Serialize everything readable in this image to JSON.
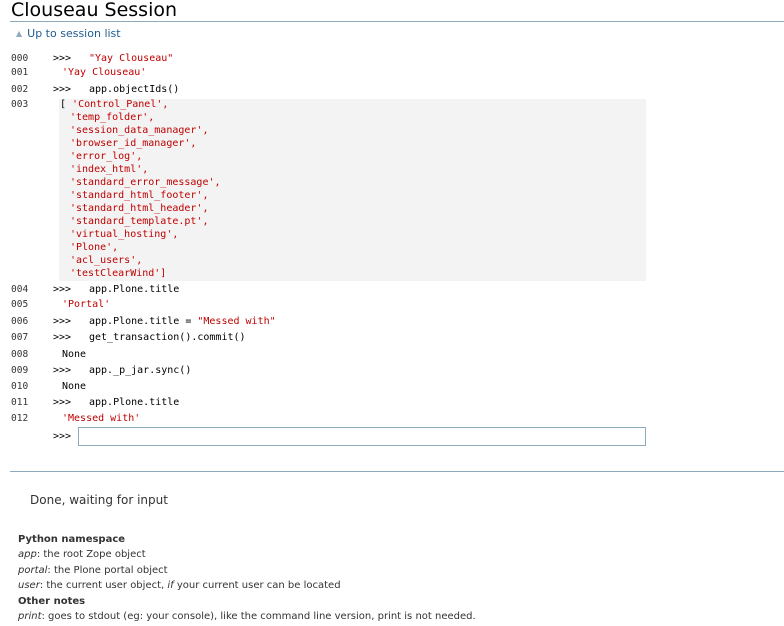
{
  "header": {
    "title": "Clouseau Session",
    "up_link": "Up to session list"
  },
  "console": {
    "prompt": ">>>",
    "rows": [
      {
        "n": "000",
        "kind": "in",
        "code": "",
        "str": "\"Yay Clouseau\""
      },
      {
        "n": "001",
        "kind": "out",
        "text": "'Yay Clouseau'",
        "red": true
      },
      {
        "n": "002",
        "kind": "in",
        "code": "app.objectIds()",
        "str": ""
      },
      {
        "n": "003",
        "kind": "list"
      },
      {
        "n": "004",
        "kind": "in",
        "code": "app.Plone.title",
        "str": ""
      },
      {
        "n": "005",
        "kind": "out",
        "text": "'Portal'",
        "red": true
      },
      {
        "n": "006",
        "kind": "in",
        "code": "app.Plone.title = ",
        "str": "\"Messed with\""
      },
      {
        "n": "007",
        "kind": "in",
        "code": "get_transaction().commit()",
        "str": ""
      },
      {
        "n": "008",
        "kind": "out",
        "text": "None",
        "red": false
      },
      {
        "n": "009",
        "kind": "in",
        "code": "app._p_jar.sync()",
        "str": ""
      },
      {
        "n": "010",
        "kind": "out",
        "text": "None",
        "red": false
      },
      {
        "n": "011",
        "kind": "in",
        "code": "app.Plone.title",
        "str": ""
      },
      {
        "n": "012",
        "kind": "out",
        "text": "'Messed with'",
        "red": true
      }
    ],
    "list_items": [
      "'Control_Panel',",
      "'temp_folder',",
      "'session_data_manager',",
      "'browser_id_manager',",
      "'error_log',",
      "'index_html',",
      "'standard_error_message',",
      "'standard_html_footer',",
      "'standard_html_header',",
      "'standard_template.pt',",
      "'virtual_hosting',",
      "'Plone',",
      "'acl_users',",
      "'testClearWind']"
    ],
    "input_value": ""
  },
  "status": "Done, waiting for input",
  "help": {
    "python_namespace_heading": "Python namespace",
    "app_key": "app",
    "app_desc": ": the root Zope object",
    "portal_key": "portal",
    "portal_desc": ": the Plone portal object",
    "user_key": "user",
    "user_desc_a": ": the current user object, ",
    "user_if": "if",
    "user_desc_b": " your current user can be located",
    "other_notes_heading": "Other notes",
    "print_key": "print",
    "print_desc": ": goes to stdout (eg: your console), like the command line version, print is not needed."
  }
}
